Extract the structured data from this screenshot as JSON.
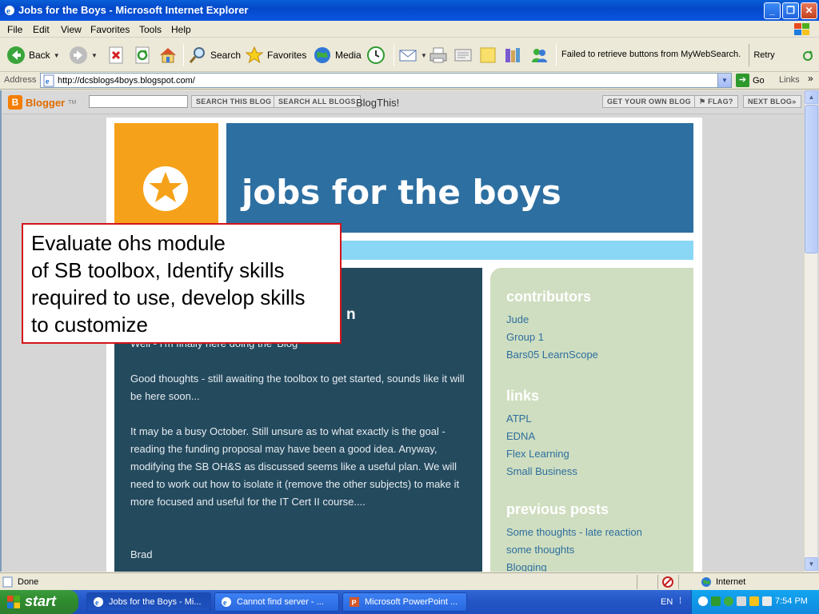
{
  "window": {
    "title": "Jobs for the Boys - Microsoft Internet Explorer",
    "minimize": "_",
    "maximize": "❐",
    "close": "✕"
  },
  "menu": [
    "File",
    "Edit",
    "View",
    "Favorites",
    "Tools",
    "Help"
  ],
  "toolbar": {
    "back": "Back",
    "search": "Search",
    "favorites": "Favorites",
    "media": "Media",
    "mywebsearch_message": "Failed to retrieve buttons from MyWebSearch.",
    "retry": "Retry"
  },
  "address": {
    "label": "Address",
    "url": "http://dcsblogs4boys.blogspot.com/",
    "go": "Go",
    "links": "Links"
  },
  "navbar": {
    "brand": "Blogger",
    "tm": "TM",
    "search_this_blog": "SEARCH THIS BLOG",
    "search_all_blogs": "SEARCH ALL BLOGS",
    "blogthis": "BlogThis!",
    "get_your_own_blog": "GET YOUR OWN BLOG",
    "flag": "FLAG?",
    "next_blog": "NEXT BLOG»"
  },
  "blog": {
    "title": "jobs for the boys",
    "post_title_fragment": "n",
    "post_paragraphs": [
      "Well - I'm finally here doing the 'Blog'",
      "Good thoughts - still awaiting the toolbox to get started, sounds like it will be here soon...",
      "It may be a busy October. Still unsure as to what exactly is the goal - reading the funding proposal may have been a good idea. Anyway, modifying the SB OH&S as discussed seems like a useful plan. We will need to work out how to isolate it (remove the other subjects) to make it more focused and useful for the IT Cert II course....",
      "Brad"
    ],
    "sidebar": {
      "contributors_heading": "contributors",
      "contributors": [
        "Jude",
        "Group 1",
        "Bars05 LearnScope"
      ],
      "links_heading": "links",
      "links": [
        "ATPL",
        "EDNA",
        "Flex Learning",
        "Small Business"
      ],
      "previous_heading": "previous posts",
      "previous": [
        "Some thoughts - late reaction",
        "some thoughts",
        "Blogging"
      ]
    }
  },
  "callout": {
    "lines": [
      "Evaluate ohs module",
      "of SB toolbox, Identify skills",
      "required to use, develop skills",
      "to customize"
    ]
  },
  "status": {
    "text": "Done",
    "zone": "Internet"
  },
  "taskbar": {
    "start": "start",
    "tasks": [
      "Jobs for the Boys - Mi...",
      "Cannot find server - ...",
      "Microsoft PowerPoint ..."
    ],
    "language": "EN",
    "time": "7:54 PM"
  },
  "colors": {
    "blog_header": "#2d6fa1",
    "blog_orange": "#f6a11a",
    "blog_main": "#244a5e",
    "blog_sidebar": "#cfdec0",
    "callout_border": "#d4141a"
  }
}
